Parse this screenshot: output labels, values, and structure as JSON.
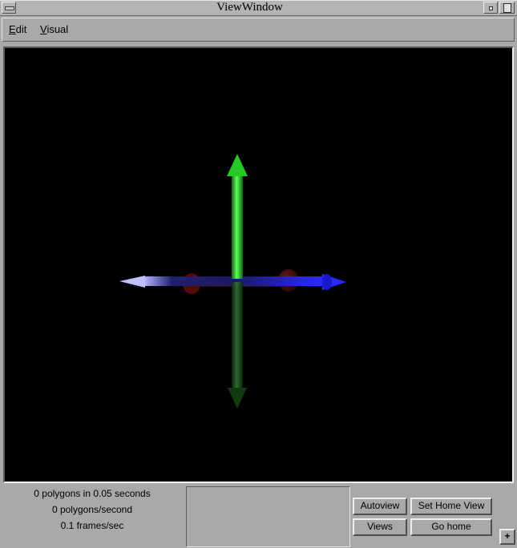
{
  "window": {
    "title": "ViewWindow"
  },
  "menu": {
    "edit": {
      "mnemonic": "E",
      "rest": "dit"
    },
    "visual": {
      "mnemonic": "V",
      "rest": "isual"
    }
  },
  "viewport": {
    "background": "#000000",
    "axis_colors": {
      "x": "#1a1aff",
      "y": "#22cc22",
      "z": "#8b0000"
    }
  },
  "status": {
    "polygons_time": "0 polygons in 0.05 seconds",
    "polygons_rate": "0 polygons/second",
    "frame_rate": "0.1 frames/sec"
  },
  "buttons": {
    "autoview": "Autoview",
    "set_home_view": "Set Home View",
    "views": "Views",
    "go_home": "Go home",
    "corner": "+"
  }
}
